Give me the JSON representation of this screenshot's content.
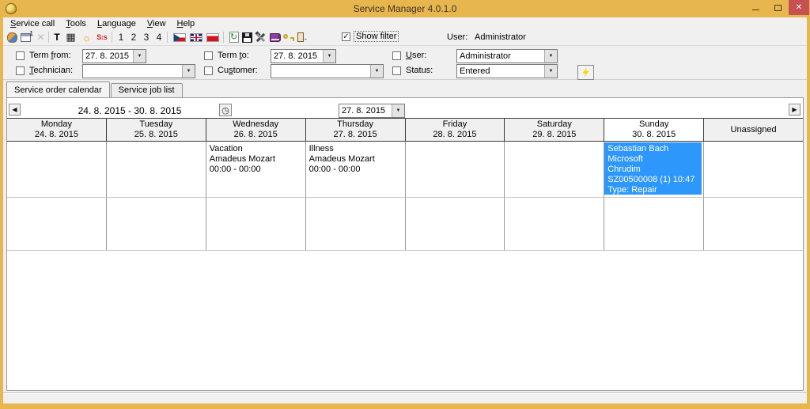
{
  "window": {
    "title": "Service Manager 4.0.1.0"
  },
  "glyphs": {
    "close": "✕",
    "combo_arrow": "▼",
    "check": "✓",
    "prev": "◀",
    "next": "▶",
    "clock": "◷",
    "delete": "✕",
    "grid": "▦",
    "sun": "☼",
    "refresh": "↻",
    "sort": "S↕s",
    "t_button": "T",
    "exit_arrow": "→",
    "props_sup": "1"
  },
  "menu": {
    "items": [
      {
        "pre": "",
        "key": "S",
        "post": "ervice call"
      },
      {
        "pre": "",
        "key": "T",
        "post": "ools"
      },
      {
        "pre": "",
        "key": "L",
        "post": "anguage"
      },
      {
        "pre": "",
        "key": "V",
        "post": "iew"
      },
      {
        "pre": "",
        "key": "H",
        "post": "elp"
      }
    ]
  },
  "toolbar": {
    "numbers": [
      "1",
      "2",
      "3",
      "4"
    ],
    "show_filter_label": "Show filter",
    "user_label": "User:",
    "user_value": "Administrator"
  },
  "filters": {
    "term_from": {
      "pre": "Term ",
      "key": "f",
      "post": "rom:",
      "value": "27. 8. 2015"
    },
    "technician": {
      "pre": "",
      "key": "T",
      "post": "echnician:",
      "value": ""
    },
    "term_to": {
      "pre": "Term ",
      "key": "t",
      "post": "o:",
      "value": "27. 8. 2015"
    },
    "customer": {
      "pre": "Cu",
      "key": "s",
      "post": "tomer:",
      "value": ""
    },
    "user": {
      "pre": "",
      "key": "U",
      "post": "ser:",
      "value": "Administrator"
    },
    "status": {
      "pre": "Status:",
      "key": "",
      "post": "",
      "value": "Entered"
    }
  },
  "tabs": [
    {
      "label": "Service order calendar"
    },
    {
      "label": "Service job list"
    }
  ],
  "calendar": {
    "range_text": "24. 8. 2015 - 30. 8. 2015",
    "date_picker_value": "27. 8. 2015",
    "columns": [
      {
        "day": "Monday",
        "date": "24. 8. 2015"
      },
      {
        "day": "Tuesday",
        "date": "25. 8. 2015"
      },
      {
        "day": "Wednesday",
        "date": "26. 8. 2015"
      },
      {
        "day": "Thursday",
        "date": "27. 8. 2015"
      },
      {
        "day": "Friday",
        "date": "28. 8. 2015"
      },
      {
        "day": "Saturday",
        "date": "29. 8. 2015"
      },
      {
        "day": "Sunday",
        "date": "30. 8. 2015"
      },
      {
        "day": "Unassigned",
        "date": ""
      }
    ],
    "events": [
      {
        "column": "Wednesday 26. 8. 2015",
        "highlighted": false,
        "lines": [
          "Vacation",
          "Amadeus Mozart",
          "00:00 - 00:00"
        ]
      },
      {
        "column": "Thursday 27. 8. 2015",
        "highlighted": false,
        "lines": [
          "Illness",
          "Amadeus Mozart",
          "00:00 - 00:00"
        ]
      },
      {
        "column": "Sunday 30. 8. 2015",
        "highlighted": true,
        "lines": [
          "Sebastian Bach",
          "Microsoft",
          "Chrudim",
          "SZ00500008 (1) 10:47",
          "Type: Repair"
        ]
      }
    ]
  },
  "colors": {
    "titlebar": "#E8B64E",
    "close_button": "#C75050",
    "selected_event": "#2E97FC"
  }
}
